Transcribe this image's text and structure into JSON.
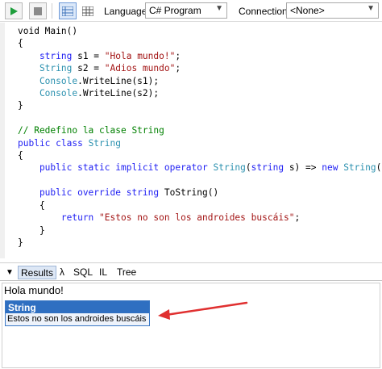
{
  "toolbar": {
    "language_label": "Language",
    "language_value": "C# Program",
    "connection_label": "Connection",
    "connection_value": "<None>"
  },
  "editor": {
    "lines": [
      [
        {
          "t": "void Main()",
          "c": ""
        }
      ],
      [
        {
          "t": "{",
          "c": ""
        }
      ],
      [
        {
          "t": "    string ",
          "c": "kw"
        },
        {
          "t": "s1 = ",
          "c": ""
        },
        {
          "t": "\"Hola mundo!\"",
          "c": "st"
        },
        {
          "t": ";",
          "c": ""
        }
      ],
      [
        {
          "t": "    String ",
          "c": "ty"
        },
        {
          "t": "s2 = ",
          "c": ""
        },
        {
          "t": "\"Adios mundo\"",
          "c": "st"
        },
        {
          "t": ";",
          "c": ""
        }
      ],
      [
        {
          "t": "    Console",
          "c": "ty"
        },
        {
          "t": ".WriteLine(s1);",
          "c": ""
        }
      ],
      [
        {
          "t": "    Console",
          "c": "ty"
        },
        {
          "t": ".WriteLine(s2);",
          "c": ""
        }
      ],
      [
        {
          "t": "}",
          "c": ""
        }
      ],
      [
        {
          "t": "",
          "c": ""
        }
      ],
      [
        {
          "t": "// Redefino la clase String",
          "c": "cm"
        }
      ],
      [
        {
          "t": "public class ",
          "c": "kw"
        },
        {
          "t": "String",
          "c": "ty"
        }
      ],
      [
        {
          "t": "{",
          "c": ""
        }
      ],
      [
        {
          "t": "    public static implicit operator ",
          "c": "kw"
        },
        {
          "t": "String",
          "c": "ty"
        },
        {
          "t": "(",
          "c": ""
        },
        {
          "t": "string ",
          "c": "kw"
        },
        {
          "t": "s) => ",
          "c": ""
        },
        {
          "t": "new ",
          "c": "kw"
        },
        {
          "t": "String",
          "c": "ty"
        },
        {
          "t": "();",
          "c": ""
        }
      ],
      [
        {
          "t": "",
          "c": ""
        }
      ],
      [
        {
          "t": "    public override string ",
          "c": "kw"
        },
        {
          "t": "ToString()",
          "c": ""
        }
      ],
      [
        {
          "t": "    {",
          "c": ""
        }
      ],
      [
        {
          "t": "        return ",
          "c": "kw"
        },
        {
          "t": "\"Estos no son los androides buscáis\"",
          "c": "st"
        },
        {
          "t": ";",
          "c": ""
        }
      ],
      [
        {
          "t": "    }",
          "c": ""
        }
      ],
      [
        {
          "t": "}",
          "c": ""
        }
      ]
    ]
  },
  "results_tabs": {
    "toggle": "▼",
    "results": "Results",
    "lambda": "λ",
    "sql": "SQL",
    "il": "IL",
    "tree": "Tree"
  },
  "output": {
    "line1": "Hola mundo!",
    "result_type": "String",
    "result_value": "Estos no son los androides buscáis"
  },
  "colors": {
    "keyword": "#1f1ff3",
    "type": "#2b91af",
    "string": "#a31515",
    "comment": "#008000",
    "result_header": "#2f6fc1",
    "annotation_arrow": "#e03030"
  }
}
